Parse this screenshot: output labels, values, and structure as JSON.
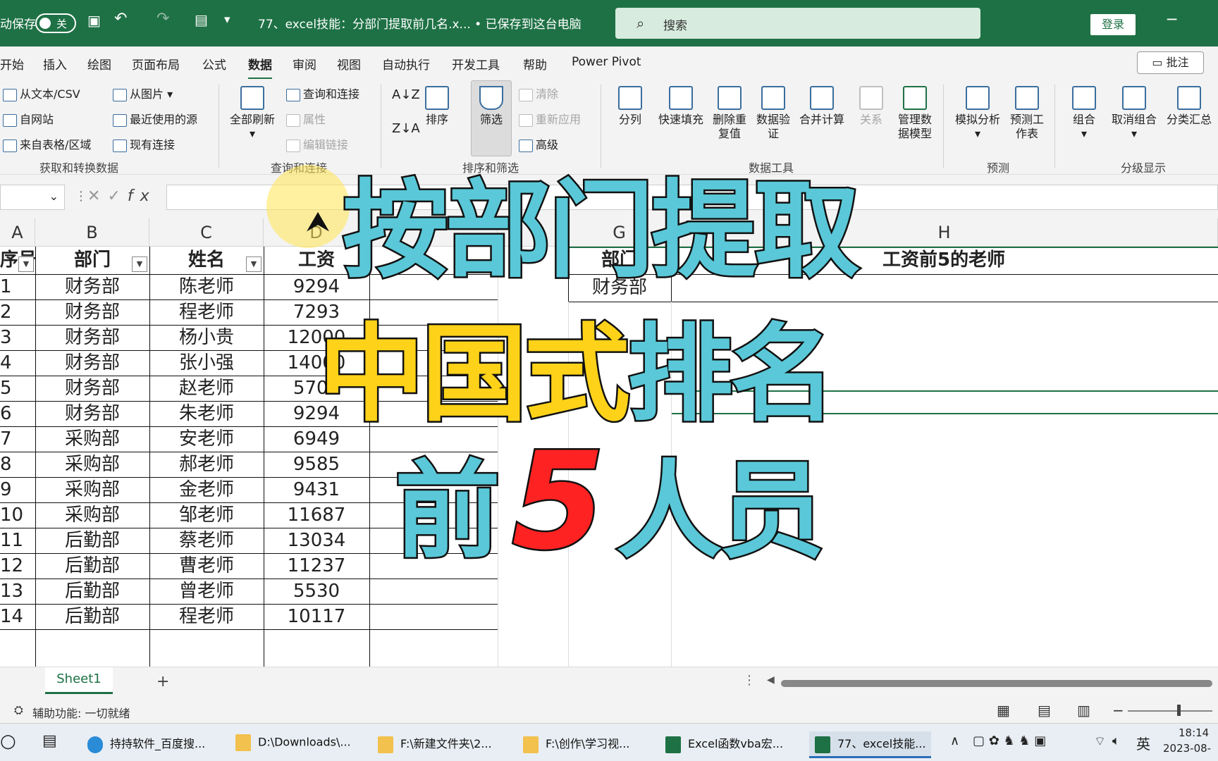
{
  "titlebar": {
    "autosave_label": "动保存",
    "autosave_state": "关",
    "document_title": "77、excel技能：分部门提取前几名.x... • 已保存到这台电脑",
    "search_placeholder": "搜索",
    "login_label": "登录"
  },
  "tabs": [
    "开始",
    "插入",
    "绘图",
    "页面布局",
    "公式",
    "数据",
    "审阅",
    "视图",
    "自动执行",
    "开发工具",
    "帮助",
    "Power Pivot"
  ],
  "active_tab": "数据",
  "comment_button": "批注",
  "ribbon": {
    "get_data": {
      "items": [
        "从文本/CSV",
        "自网站",
        "来自表格/区域",
        "从图片",
        "最近使用的源",
        "现有连接"
      ],
      "group_label": "获取和转换数据"
    },
    "queries": {
      "refresh_all": "全部刷新",
      "items": [
        "查询和连接",
        "属性",
        "编辑链接"
      ],
      "group_label": "查询和连接"
    },
    "sort_filter": {
      "sort": "排序",
      "filter": "筛选",
      "items": [
        "清除",
        "重新应用",
        "高级"
      ],
      "group_label": "排序和筛选"
    },
    "data_tools": {
      "items": [
        "分列",
        "快速填充",
        "删除重复值",
        "数据验证",
        "合并计算",
        "关系",
        "管理数据模型"
      ],
      "group_label": "数据工具"
    },
    "forecast": {
      "items": [
        "模拟分析",
        "预测工作表"
      ],
      "group_label": "预测"
    },
    "outline": {
      "items": [
        "组合",
        "取消组合",
        "分类汇总"
      ],
      "group_label": "分级显示"
    }
  },
  "formula_bar": {
    "fx": "fx"
  },
  "columns": [
    "A",
    "B",
    "C",
    "D",
    "G",
    "H"
  ],
  "table": {
    "headers": [
      "序号",
      "部门",
      "姓名",
      "工资"
    ],
    "rows": [
      [
        "1",
        "财务部",
        "陈老师",
        "9294"
      ],
      [
        "2",
        "财务部",
        "程老师",
        "7293"
      ],
      [
        "3",
        "财务部",
        "杨小贵",
        "12000"
      ],
      [
        "4",
        "财务部",
        "张小强",
        "14000"
      ],
      [
        "5",
        "财务部",
        "赵老师",
        "5700"
      ],
      [
        "6",
        "财务部",
        "朱老师",
        "9294"
      ],
      [
        "7",
        "采购部",
        "安老师",
        "6949"
      ],
      [
        "8",
        "采购部",
        "郝老师",
        "9585"
      ],
      [
        "9",
        "采购部",
        "金老师",
        "9431"
      ],
      [
        "10",
        "采购部",
        "邹老师",
        "11687"
      ],
      [
        "11",
        "后勤部",
        "蔡老师",
        "13034"
      ],
      [
        "12",
        "后勤部",
        "曹老师",
        "11237"
      ],
      [
        "13",
        "后勤部",
        "曾老师",
        "5530"
      ],
      [
        "14",
        "后勤部",
        "程老师",
        "10117"
      ]
    ]
  },
  "right_table": {
    "dept_header": "部门",
    "result_header": "工资前5的老师",
    "dept_value": "财务部"
  },
  "overlay": {
    "line1": "按部门提取",
    "line2": "中国式排名",
    "line3_a": "前",
    "line3_b": "5",
    "line3_c": "人员"
  },
  "sheets": [
    "Sheet1"
  ],
  "add_sheet": "+",
  "status": {
    "text": "辅助功能: 一切就绪"
  },
  "taskbar": {
    "items": [
      "持持软件_百度搜...",
      "D:\\Downloads\\...",
      "F:\\新建文件夹\\2...",
      "F:\\创作\\学习视...",
      "Excel函数vba宏...",
      "77、excel技能..."
    ],
    "ime": "英",
    "time": "18:14",
    "date": "2023-08-"
  },
  "colors": {
    "excel_green": "#1e7145",
    "overlay_cyan": "#5ac8d8",
    "overlay_yellow": "#ffd21a",
    "overlay_red": "#ff2222"
  }
}
